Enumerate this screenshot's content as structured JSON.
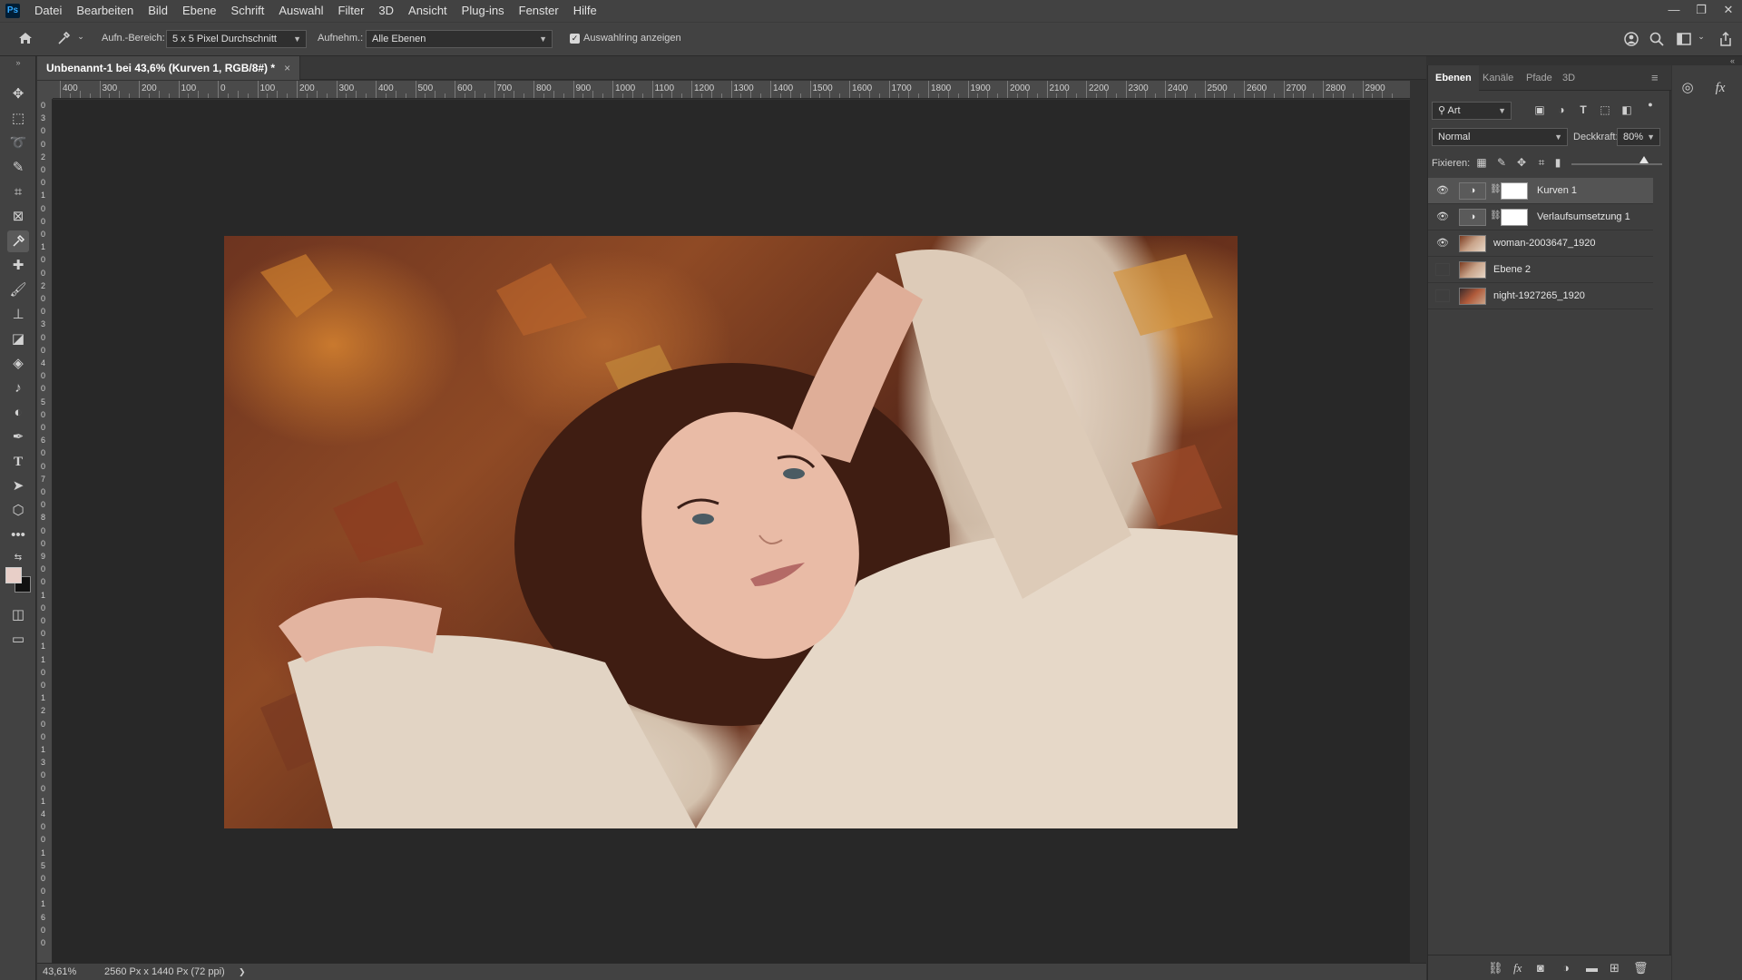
{
  "app": {
    "logo": "Ps"
  },
  "menubar": {
    "items": [
      "Datei",
      "Bearbeiten",
      "Bild",
      "Ebene",
      "Schrift",
      "Auswahl",
      "Filter",
      "3D",
      "Ansicht",
      "Plug-ins",
      "Fenster",
      "Hilfe"
    ],
    "window_controls": [
      "—",
      "❐",
      "✕"
    ]
  },
  "options": {
    "sample_size_label": "Aufn.-Bereich:",
    "sample_size_value": "5 x 5 Pixel Durchschnitt",
    "sample_label": "Aufnehm.:",
    "sample_value": "Alle Ebenen",
    "show_ring_label": "Auswahlring anzeigen",
    "show_ring_checked": true
  },
  "document": {
    "tab_title": "Unbenannt-1 bei 43,6% (Kurven 1, RGB/8#) *",
    "close_glyph": "×",
    "ruler_labels": [
      "400",
      "300",
      "200",
      "100",
      "0",
      "100",
      "200",
      "300",
      "400",
      "500",
      "600",
      "700",
      "800",
      "900",
      "1000",
      "1100",
      "1200",
      "1300",
      "1400",
      "1500",
      "1600",
      "1700",
      "1800",
      "1900",
      "2000",
      "2100",
      "2200",
      "2300",
      "2400",
      "2500",
      "2600",
      "2700",
      "2800",
      "2900"
    ],
    "vertical_ruler_chars": [
      "0",
      "3",
      "0",
      "0",
      "2",
      "0",
      "0",
      "1",
      "0",
      "0",
      "0",
      "1",
      "0",
      "0",
      "2",
      "0",
      "0",
      "3",
      "0",
      "0",
      "4",
      "0",
      "0",
      "5",
      "0",
      "0",
      "6",
      "0",
      "0",
      "7",
      "0",
      "0",
      "8",
      "0",
      "0",
      "9",
      "0",
      "0",
      "1",
      "0",
      "0",
      "0",
      "1",
      "1",
      "0",
      "0",
      "1",
      "2",
      "0",
      "0",
      "1",
      "3",
      "0",
      "0",
      "1",
      "4",
      "0",
      "0",
      "1",
      "5",
      "0",
      "0",
      "1",
      "6",
      "0",
      "0"
    ]
  },
  "status": {
    "zoom": "43,61%",
    "dimensions": "2560 Px x 1440 Px (72 ppi)",
    "arrow": "❯"
  },
  "layers_panel": {
    "tabs": [
      "Ebenen",
      "Kanäle",
      "Pfade",
      "3D"
    ],
    "active_tab": "Ebenen",
    "filter_value": "Art",
    "blend_mode": "Normal",
    "opacity_label": "Deckkraft:",
    "opacity_value": "80%",
    "opacity_fraction": 0.8,
    "lock_label": "Fixieren:",
    "layers": [
      {
        "name": "Kurven 1",
        "visible": true,
        "selected": true,
        "type": "adjustment"
      },
      {
        "name": "Verlaufsumsetzung 1",
        "visible": true,
        "selected": false,
        "type": "adjustment"
      },
      {
        "name": "woman-2003647_1920",
        "visible": true,
        "selected": false,
        "type": "photo"
      },
      {
        "name": "Ebene 2",
        "visible": false,
        "selected": false,
        "type": "photo"
      },
      {
        "name": "night-1927265_1920",
        "visible": false,
        "selected": false,
        "type": "night"
      }
    ]
  },
  "colors": {
    "foreground": "#e8cfc8",
    "background": "#111111"
  }
}
